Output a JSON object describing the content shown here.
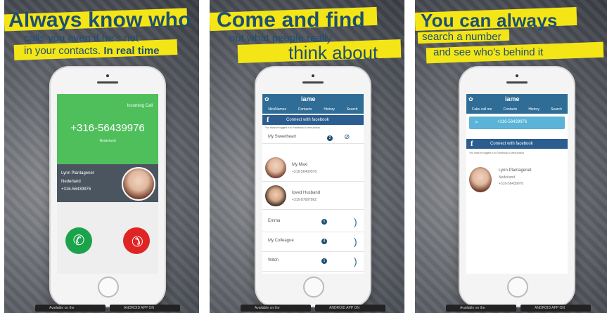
{
  "panel1": {
    "line1": "Always know who",
    "line2": "calls you even if he's not",
    "line3a": "in your contacts.",
    "line3b": "In real time",
    "screen": {
      "status": "Incoming Call",
      "number": "+316-56439976",
      "country": "Nederland",
      "caller_name": "Lynn Plantagenet",
      "caller_country": "Nederland",
      "caller_number": "+316-56439976"
    }
  },
  "panel2": {
    "line1": "Come and find",
    "line2": "out what people really",
    "line3": "think about",
    "screen": {
      "logo": "iame",
      "tabs": [
        "NickNames",
        "Contacts",
        "History",
        "Search"
      ],
      "fb_label": "Connect with facebook",
      "note": "You must be logged in to Facebook to view photos",
      "sweet_label": "My Sweetheart",
      "sweet_count": "2",
      "contacts": [
        {
          "name": "My Maxi",
          "number": "+316-56439976"
        },
        {
          "name": "loved Husband",
          "number": "+316-87697862"
        }
      ],
      "groups": [
        {
          "name": "Emma",
          "count": "5"
        },
        {
          "name": "My Colleague",
          "count": "4"
        },
        {
          "name": "Witch",
          "count": "1"
        }
      ]
    }
  },
  "panel3": {
    "line1": "You can always",
    "line2": "search a number",
    "line3": "and see who's behind it",
    "screen": {
      "logo": "iame",
      "tabs": [
        "Fake call me",
        "Contacts",
        "History",
        "Search"
      ],
      "search_value": "+316-56439976",
      "fb_label": "Connect with facebook",
      "note": "You must be logged in to Facebook to view photos",
      "result_name": "Lynn Plantagenet",
      "result_country": "Nederland",
      "result_number": "+316-56439976"
    }
  },
  "badges": {
    "left": "Available on the",
    "right": "ANDROID APP ON"
  },
  "colors": {
    "title": "#1d4f72",
    "highlight": "#f4e516",
    "accept": "#1aa34a",
    "decline": "#e02424",
    "app": "#2f6d96"
  }
}
